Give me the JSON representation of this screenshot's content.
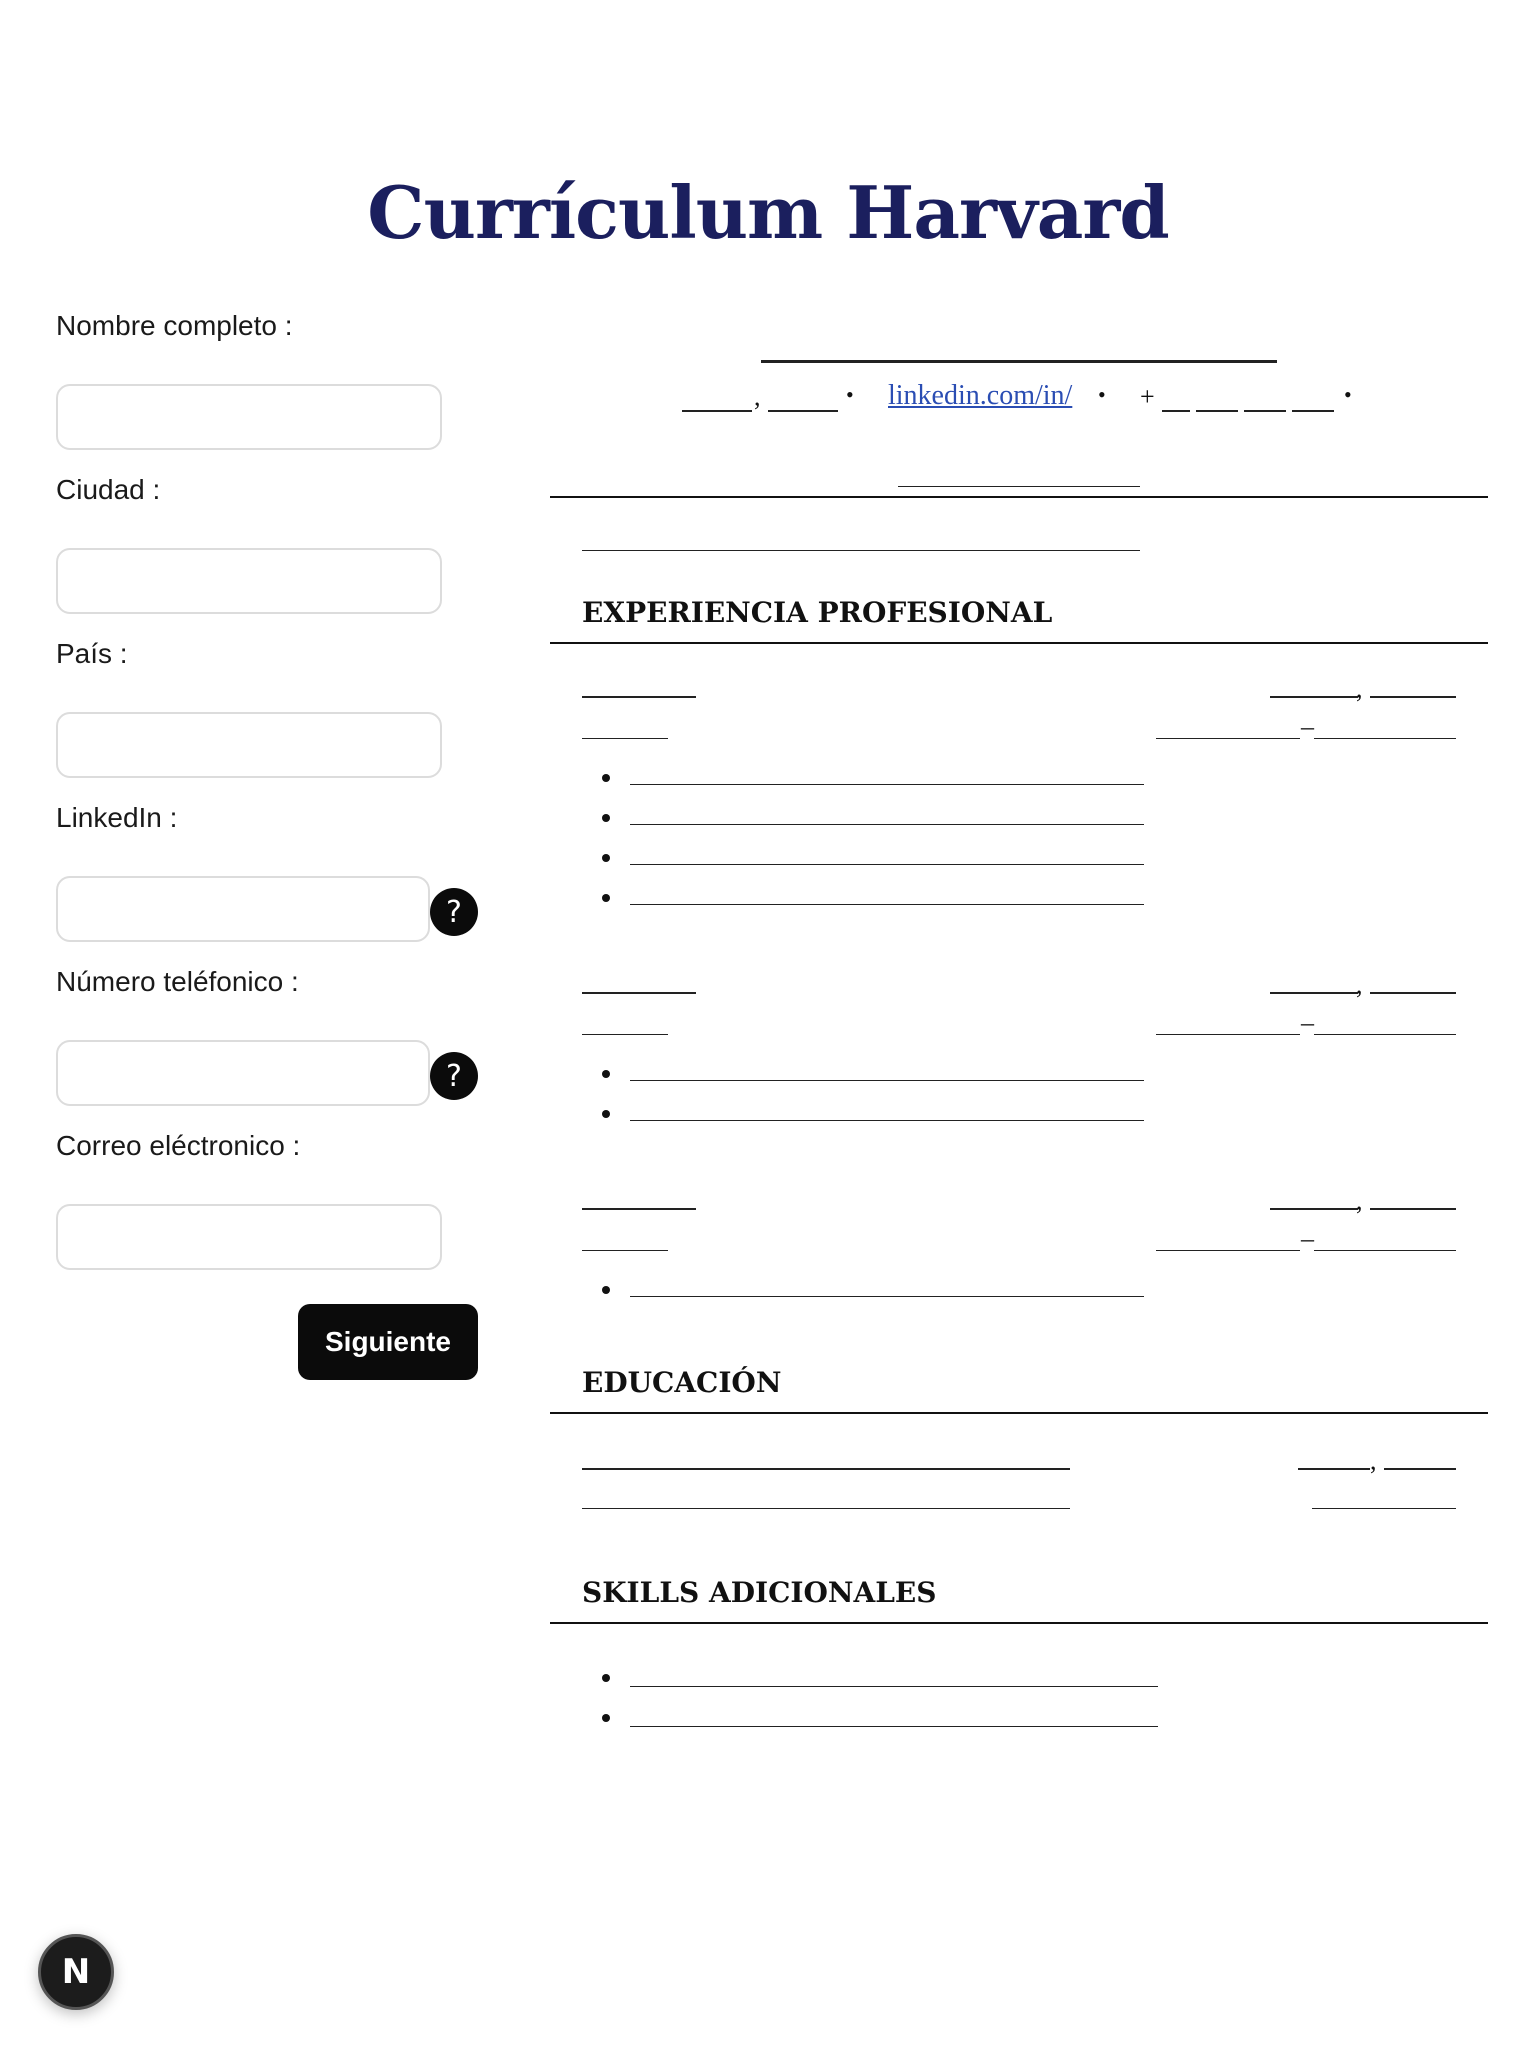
{
  "page": {
    "title": "Currículum Harvard"
  },
  "form": {
    "fields": [
      {
        "label": "Nombre completo :",
        "value": "",
        "placeholder": ""
      },
      {
        "label": "Ciudad :",
        "value": "",
        "placeholder": ""
      },
      {
        "label": "País :",
        "value": "",
        "placeholder": ""
      },
      {
        "label": "LinkedIn :",
        "value": "",
        "placeholder": "",
        "help": "?"
      },
      {
        "label": "Número teléfonico :",
        "value": "",
        "placeholder": "",
        "help": "?"
      },
      {
        "label": "Correo eléctronico :",
        "value": "",
        "placeholder": ""
      }
    ],
    "next_label": "Siguiente"
  },
  "preview": {
    "linkedin_prefix": "linkedin.com/in/",
    "phone_plus": "+",
    "comma": ",",
    "dash": "–",
    "sections": {
      "experience": "EXPERIENCIA PROFESIONAL",
      "education": "EDUCACIÓN",
      "skills": "SKILLS ADICIONALES"
    }
  },
  "badge": {
    "letter": "N"
  }
}
